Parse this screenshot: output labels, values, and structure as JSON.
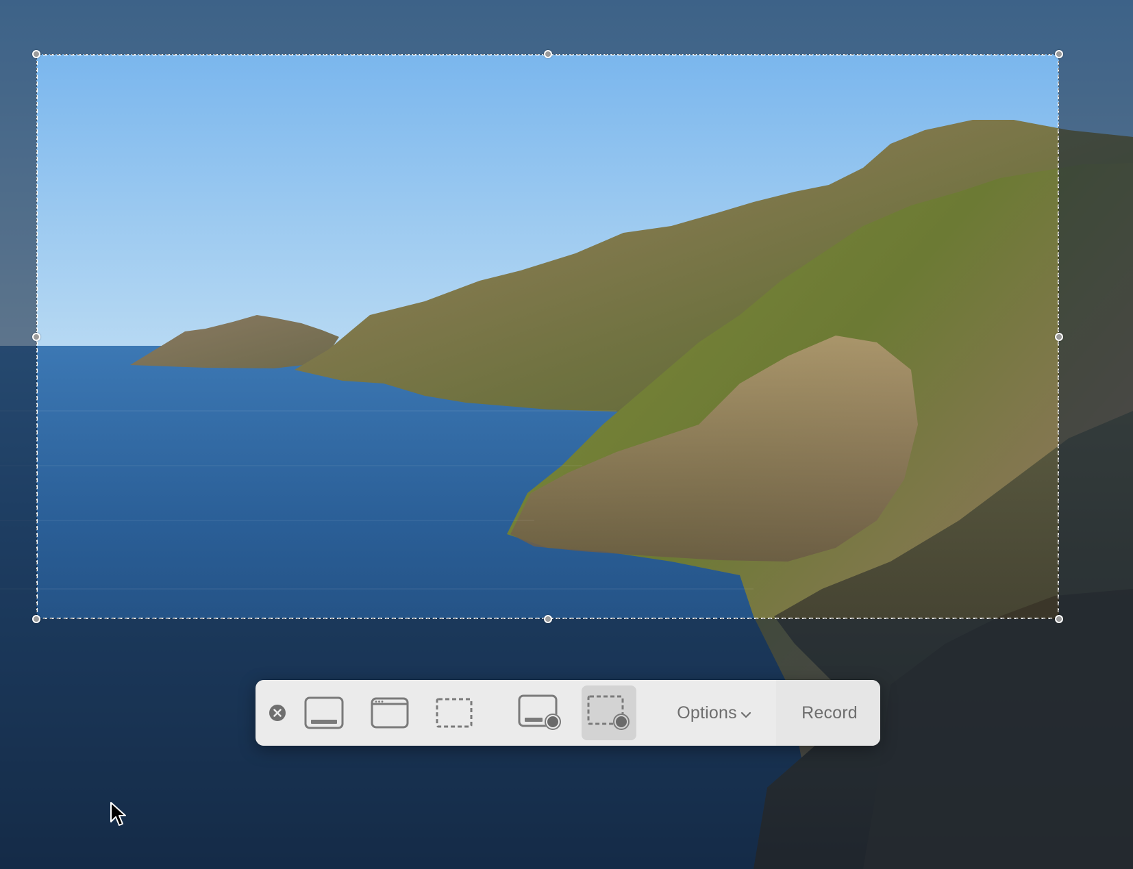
{
  "toolbar": {
    "close_icon": "close-circle-icon",
    "buttons": [
      {
        "name": "capture-entire-screen-button",
        "icon": "entire-screen-icon"
      },
      {
        "name": "capture-window-button",
        "icon": "window-icon"
      },
      {
        "name": "capture-selection-button",
        "icon": "dashed-selection-icon"
      },
      {
        "name": "record-entire-screen-button",
        "icon": "record-screen-icon"
      },
      {
        "name": "record-selection-button",
        "icon": "record-selection-icon",
        "active": true
      }
    ],
    "options_label": "Options",
    "options_chevron_icon": "chevron-down-icon",
    "record_label": "Record"
  },
  "selection": {
    "style": "dashed",
    "handles": 8
  },
  "colors": {
    "toolbar_bg": "#ebebeb",
    "toolbar_active": "#d3d3d3",
    "icon_gray": "#7a7a7a",
    "text_gray": "#6e6e6e"
  },
  "wallpaper": "coastal-cliffs-ocean"
}
